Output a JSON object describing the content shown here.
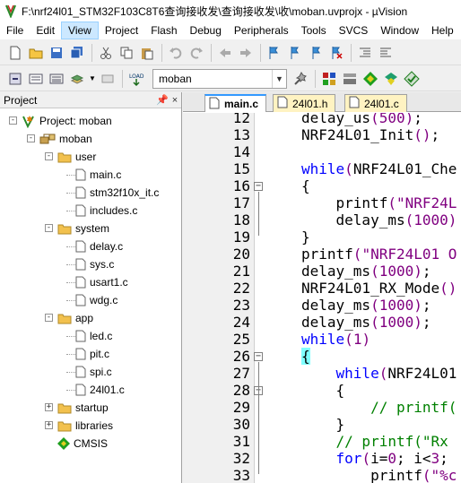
{
  "window": {
    "title": "F:\\nrf24l01_STM32F103C8T6查询接收发\\查询接收发\\收\\moban.uvprojx - µVision"
  },
  "menu": [
    "File",
    "Edit",
    "View",
    "Project",
    "Flash",
    "Debug",
    "Peripherals",
    "Tools",
    "SVCS",
    "Window",
    "Help"
  ],
  "menu_active": "View",
  "toolbar": {
    "target": "moban"
  },
  "project_panel": {
    "title": "Project",
    "pin": "ᵖ",
    "close": "×",
    "root": "Project: moban",
    "target": "moban",
    "groups": [
      {
        "name": "user",
        "files": [
          "main.c",
          "stm32f10x_it.c",
          "includes.c"
        ]
      },
      {
        "name": "system",
        "files": [
          "delay.c",
          "sys.c",
          "usart1.c",
          "wdg.c"
        ]
      },
      {
        "name": "app",
        "files": [
          "led.c",
          "pit.c",
          "spi.c",
          "24l01.c"
        ]
      },
      {
        "name": "startup",
        "files": []
      },
      {
        "name": "libraries",
        "files": []
      }
    ],
    "extra": "CMSIS"
  },
  "tabs": [
    {
      "label": "main.c",
      "active": true
    },
    {
      "label": "24l01.h",
      "active": false
    },
    {
      "label": "24l01.c",
      "active": false
    }
  ],
  "code": [
    {
      "n": "12",
      "t": "delay_us(500);"
    },
    {
      "n": "13",
      "t": "NRF24L01_Init();"
    },
    {
      "n": "14",
      "t": ""
    },
    {
      "n": "15",
      "t": "while(NRF24L01_Che"
    },
    {
      "n": "16",
      "t": "{"
    },
    {
      "n": "17",
      "t": "    printf(\"NRF24L"
    },
    {
      "n": "18",
      "t": "    delay_ms(1000)"
    },
    {
      "n": "19",
      "t": "}"
    },
    {
      "n": "20",
      "t": "printf(\"NRF24L01 O"
    },
    {
      "n": "21",
      "t": "delay_ms(1000);"
    },
    {
      "n": "22",
      "t": "NRF24L01_RX_Mode()"
    },
    {
      "n": "23",
      "t": "delay_ms(1000);"
    },
    {
      "n": "24",
      "t": "delay_ms(1000);"
    },
    {
      "n": "25",
      "t": "while(1)"
    },
    {
      "n": "26",
      "t": "{"
    },
    {
      "n": "27",
      "t": "    while(NRF24L01"
    },
    {
      "n": "28",
      "t": "    {"
    },
    {
      "n": "29",
      "t": "        // printf("
    },
    {
      "n": "30",
      "t": "    }"
    },
    {
      "n": "31",
      "t": "    // printf(\"Rx "
    },
    {
      "n": "32",
      "t": "    for(i=0; i<3; "
    },
    {
      "n": "33",
      "t": "        printf(\"%c"
    }
  ],
  "colors": {
    "keyword": "#0000ff",
    "string": "#800080",
    "comment": "#008000",
    "brace_highlight": "#80ffff"
  }
}
